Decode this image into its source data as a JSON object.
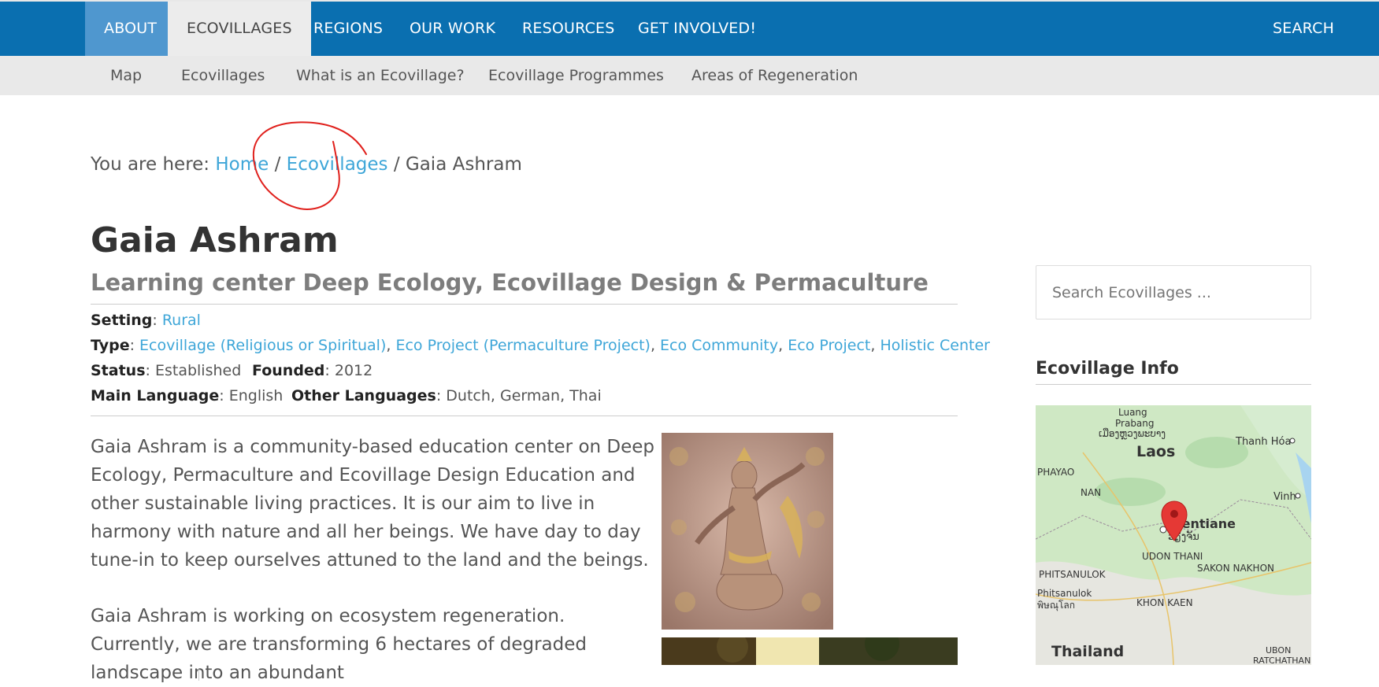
{
  "topnav": {
    "items": [
      {
        "label": "ABOUT"
      },
      {
        "label": "ECOVILLAGES"
      },
      {
        "label": "REGIONS"
      },
      {
        "label": "OUR WORK"
      },
      {
        "label": "RESOURCES"
      },
      {
        "label": "GET INVOLVED!"
      }
    ],
    "search_label": "SEARCH"
  },
  "subnav": {
    "items": [
      {
        "label": "Map"
      },
      {
        "label": "Ecovillages"
      },
      {
        "label": "What is an Ecovillage?"
      },
      {
        "label": "Ecovillage Programmes"
      },
      {
        "label": "Areas of Regeneration"
      }
    ]
  },
  "breadcrumb": {
    "prefix": "You are here: ",
    "home": "Home",
    "sep1": " / ",
    "ecovillages": "Ecovillages",
    "sep2": " / ",
    "current": "Gaia Ashram"
  },
  "page": {
    "title": "Gaia Ashram",
    "subtitle": "Learning center Deep Ecology, Ecovillage Design & Permaculture"
  },
  "meta": {
    "setting_label": "Setting",
    "setting_value": "Rural",
    "type_label": "Type",
    "types": [
      "Ecovillage (Religious or Spiritual)",
      "Eco Project (Permaculture Project)",
      "Eco Community",
      "Eco Project",
      "Holistic Center"
    ],
    "status_label": "Status",
    "status_value": "Established",
    "founded_label": "Founded",
    "founded_value": "2012",
    "main_language_label": "Main Language",
    "main_language_value": "English",
    "other_languages_label": "Other Languages",
    "other_languages_value": "Dutch, German, Thai",
    "sep": ": ",
    "comma": ", "
  },
  "content": {
    "paragraph1": "Gaia Ashram is a community-based education center on Deep Ecology, Permaculture and Ecovillage Design Education and other sustainable living practices. It is our aim to live in harmony with nature and all her beings. We have day to day tune-in to keep ourselves attuned to the land and the beings.",
    "paragraph2": "Gaia Ashram is working on ecosystem regeneration. Currently, we are transforming 6 hectares of degraded landscape into an abundant"
  },
  "sidebar": {
    "search_placeholder": "Search Ecovillages ...",
    "info_title": "Ecovillage Info",
    "map_labels": {
      "luang_prabang": "Luang",
      "luang_prabang2": "Prabang",
      "luang_prabang_lao": "ເມືອງຫຼວງພະບາງ",
      "laos": "Laos",
      "thanh_hoa": "Thanh Hóa",
      "phayao": "PHAYAO",
      "nan": "NAN",
      "vinh": "Vinh",
      "vientiane": "Vientiane",
      "vientiane_lao": "ວຽງຈັນ",
      "udon_thani": "UDON THANI",
      "sakon_nakhon": "SAKON NAKHON",
      "phitsanulok": "PHITSANULOK",
      "phitsanulok2": "Phitsanulok",
      "phitsanulok_thai1": "พิษณุโลก",
      "khon_kaen": "KHON KAEN",
      "thailand": "Thailand",
      "ubon": "UBON",
      "ratchathani": "RATCHATHANI"
    }
  },
  "colors": {
    "nav_bg": "#0a6fb0",
    "nav_active_bg": "#ececec",
    "link": "#3ea6d8",
    "annotation": "#e0201c",
    "marker": "#e53935"
  }
}
